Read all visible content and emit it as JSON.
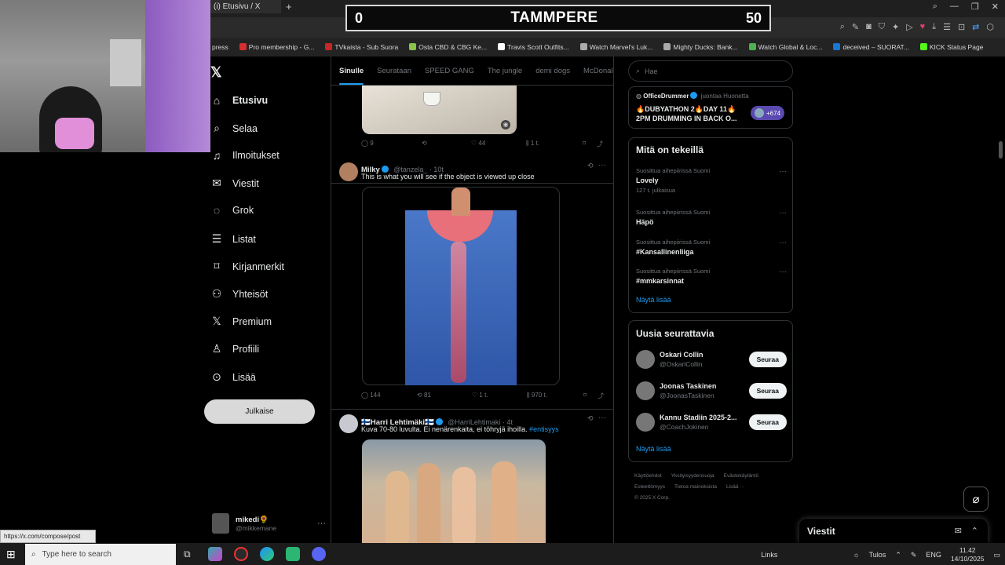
{
  "browser": {
    "tab_title": "(i) Etusivu / X",
    "new_tab_icon": "plus-icon",
    "bookmarks": [
      {
        "label": "press",
        "color": "#cccccc"
      },
      {
        "label": "Pro membership - G...",
        "color": "#d32f2f"
      },
      {
        "label": "TVkaista - Sub Suora",
        "color": "#c62828"
      },
      {
        "label": "Osta CBD & CBG Ke...",
        "color": "#8bc34a"
      },
      {
        "label": "Travis Scott Outfits...",
        "color": "#ffffff"
      },
      {
        "label": "Watch Marvel's Luk...",
        "color": "#aaaaaa"
      },
      {
        "label": "Mighty Ducks: Bank...",
        "color": "#aaaaaa"
      },
      {
        "label": "Watch Global & Loc...",
        "color": "#4caf50"
      },
      {
        "label": "deceived – SUORAT...",
        "color": "#1976d2"
      },
      {
        "label": "KICK Status Page",
        "color": "#53fc18"
      }
    ]
  },
  "scoreboard": {
    "left": "0",
    "title": "TAMMPERE",
    "right": "50"
  },
  "nav": {
    "items": [
      {
        "label": "Etusivu",
        "icon": "home-icon",
        "glyph": "⌂"
      },
      {
        "label": "Selaa",
        "icon": "search-icon",
        "glyph": "⌕"
      },
      {
        "label": "Ilmoitukset",
        "icon": "bell-icon",
        "glyph": "♫"
      },
      {
        "label": "Viestit",
        "icon": "mail-icon",
        "glyph": "✉"
      },
      {
        "label": "Grok",
        "icon": "grok-icon",
        "glyph": "◌"
      },
      {
        "label": "Listat",
        "icon": "list-icon",
        "glyph": "☰"
      },
      {
        "label": "Kirjanmerkit",
        "icon": "bookmark-icon",
        "glyph": "⌑"
      },
      {
        "label": "Yhteisöt",
        "icon": "communities-icon",
        "glyph": "⚇"
      },
      {
        "label": "Premium",
        "icon": "x-premium-icon",
        "glyph": "𝕏"
      },
      {
        "label": "Profiili",
        "icon": "profile-icon",
        "glyph": "♙"
      },
      {
        "label": "Lisää",
        "icon": "more-circle-icon",
        "glyph": "⊙"
      }
    ],
    "post_button": "Julkaise",
    "profile_name": "mikedi🌻",
    "profile_handle": "@mikkemane",
    "status_url": "https://x.com/compose/post"
  },
  "feed": {
    "tabs": [
      "Sinulle",
      "Seurataan",
      "SPEED GANG",
      "The jungle",
      "demi dogs",
      "McDonald"
    ],
    "post0_actions": {
      "replies": "9",
      "reposts": "",
      "likes": "44",
      "views": "1 t."
    },
    "post1": {
      "name": "Milky",
      "handle": "@tanzela_ · 10t",
      "text": "This is what you will see if the object is viewed up close",
      "replies": "144",
      "reposts": "81",
      "likes": "1 t.",
      "views": "970 t."
    },
    "post2": {
      "name": "🇫🇮Harri Lehtimäki🇫🇮",
      "handle": "@HarriLehtimaki · 4t",
      "text": "Kuva 70-80 luvulta. Ei nenärenkaita, ei töhryjä ihoilla.",
      "hashtag": "#entisyys"
    }
  },
  "right": {
    "search_placeholder": "Hae",
    "live": {
      "name": "OfficeDrummer",
      "action": "juontaa Huonetta",
      "title": "🔥DUBYATHON 2🔥DAY 11🔥 2PM DRUMMING IN BACK O...",
      "count": "+674"
    },
    "trends_title": "Mitä on tekeillä",
    "trends": [
      {
        "context": "Suosittua aihepiirissä Suomi",
        "name": "Lovely",
        "count": "127 t. julkaisua"
      },
      {
        "context": "Suosittua aihepiirissä Suomi",
        "name": "Häpö",
        "count": ""
      },
      {
        "context": "Suosittua aihepiirissä Suomi",
        "name": "#Kansallinenliiga",
        "count": ""
      },
      {
        "context": "Suosittua aihepiirissä Suomi",
        "name": "#mmkarsinnat",
        "count": ""
      }
    ],
    "show_more": "Näytä lisää",
    "who_title": "Uusia seurattavia",
    "who": [
      {
        "name": "Oskari Collin",
        "handle": "@OskariCollin",
        "button": "Seuraa"
      },
      {
        "name": "Joonas Taskinen",
        "handle": "@JoonasTaskinen",
        "button": "Seuraa"
      },
      {
        "name": "Kannu Stadiin 2025-2...",
        "handle": "@CoachJokinen",
        "button": "Seuraa"
      }
    ],
    "footer": [
      "Käyttöehdot",
      "Yksityisyydensuoja",
      "Evästekäytäntö",
      "Esteettömyys",
      "Tietoa mainoksista",
      "Lisää ···",
      "© 2025 X Corp."
    ],
    "messages_drawer": "Viestit"
  },
  "taskbar": {
    "search_placeholder": "Type here to search",
    "links": "Links",
    "weather": "Tulos",
    "lang": "ENG",
    "time": "11.42",
    "date": "14/10/2025"
  }
}
